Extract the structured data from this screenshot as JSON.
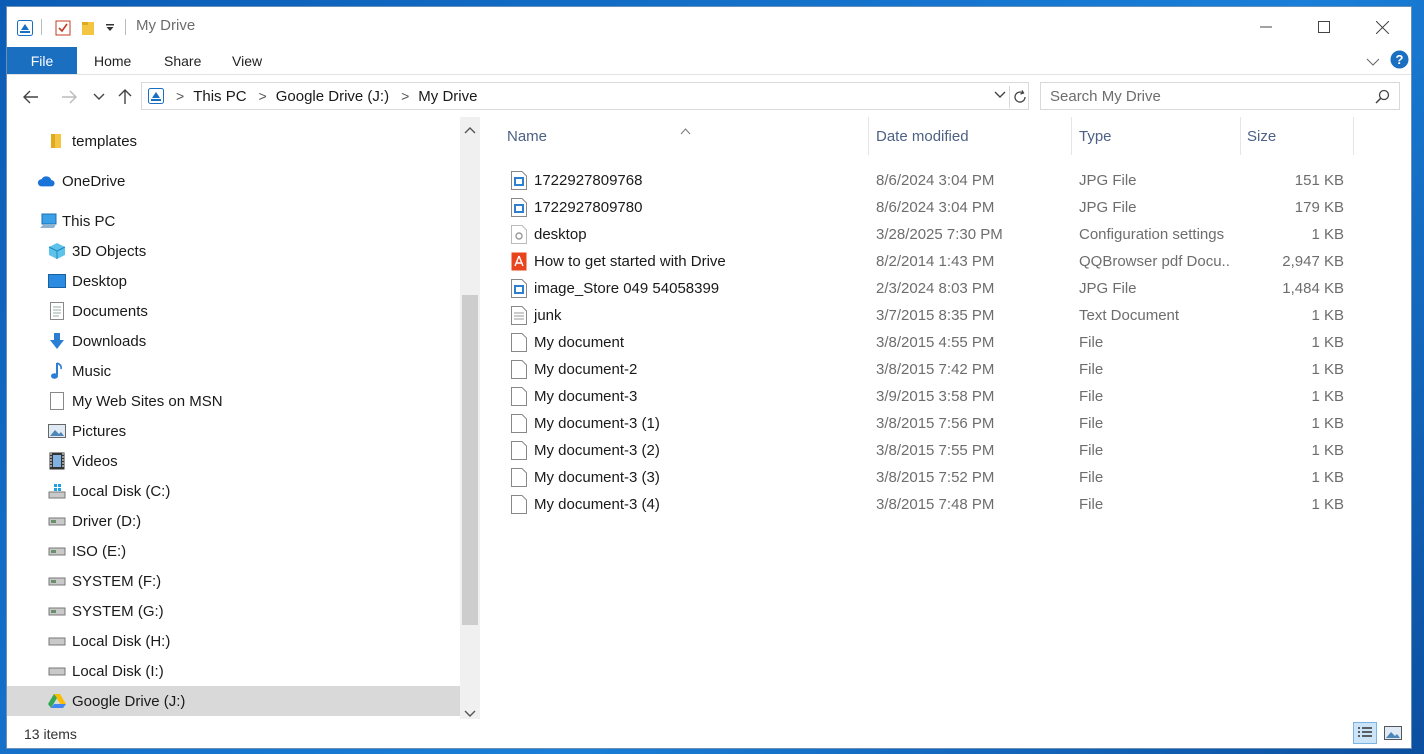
{
  "window": {
    "title": "My Drive"
  },
  "ribbon": {
    "tabs": [
      {
        "label": "File"
      },
      {
        "label": "Home"
      },
      {
        "label": "Share"
      },
      {
        "label": "View"
      }
    ]
  },
  "address": {
    "crumbs": [
      "This PC",
      "Google Drive (J:)",
      "My Drive"
    ]
  },
  "search": {
    "placeholder": "Search My Drive"
  },
  "nav": {
    "items": [
      {
        "label": "templates",
        "icon": "folder-icon"
      },
      {
        "label": "OneDrive",
        "icon": "onedrive-icon"
      },
      {
        "label": "This PC",
        "icon": "this-pc-icon"
      },
      {
        "label": "3D Objects",
        "icon": "3d-objects-icon"
      },
      {
        "label": "Desktop",
        "icon": "desktop-icon"
      },
      {
        "label": "Documents",
        "icon": "documents-icon"
      },
      {
        "label": "Downloads",
        "icon": "downloads-icon"
      },
      {
        "label": "Music",
        "icon": "music-icon"
      },
      {
        "label": "My Web Sites on MSN",
        "icon": "web-sites-icon"
      },
      {
        "label": "Pictures",
        "icon": "pictures-icon"
      },
      {
        "label": "Videos",
        "icon": "videos-icon"
      },
      {
        "label": "Local Disk (C:)",
        "icon": "windows-drive-icon"
      },
      {
        "label": "Driver (D:)",
        "icon": "drive-icon"
      },
      {
        "label": "ISO (E:)",
        "icon": "drive-icon"
      },
      {
        "label": "SYSTEM (F:)",
        "icon": "drive-icon"
      },
      {
        "label": "SYSTEM (G:)",
        "icon": "drive-icon"
      },
      {
        "label": "Local Disk (H:)",
        "icon": "drive-icon"
      },
      {
        "label": "Local Disk (I:)",
        "icon": "drive-icon"
      },
      {
        "label": "Google Drive (J:)",
        "icon": "google-drive-icon",
        "selected": true
      }
    ]
  },
  "columns": [
    {
      "label": "Name"
    },
    {
      "label": "Date modified"
    },
    {
      "label": "Type"
    },
    {
      "label": "Size"
    }
  ],
  "files": [
    {
      "name": "1722927809768",
      "date": "8/6/2024 3:04 PM",
      "type": "JPG File",
      "size": "151 KB",
      "icon": "jpg-file-icon"
    },
    {
      "name": "1722927809780",
      "date": "8/6/2024 3:04 PM",
      "type": "JPG File",
      "size": "179 KB",
      "icon": "jpg-file-icon"
    },
    {
      "name": "desktop",
      "date": "3/28/2025 7:30 PM",
      "type": "Configuration settings",
      "size": "1 KB",
      "icon": "config-file-icon"
    },
    {
      "name": "How to get started with Drive",
      "date": "8/2/2014 1:43 PM",
      "type": "QQBrowser pdf Docu...",
      "size": "2,947 KB",
      "icon": "pdf-file-icon"
    },
    {
      "name": "image_Store 049 54058399",
      "date": "2/3/2024 8:03 PM",
      "type": "JPG File",
      "size": "1,484 KB",
      "icon": "jpg-file-icon"
    },
    {
      "name": "junk",
      "date": "3/7/2015 8:35 PM",
      "type": "Text Document",
      "size": "1 KB",
      "icon": "text-file-icon"
    },
    {
      "name": "My document",
      "date": "3/8/2015 4:55 PM",
      "type": "File",
      "size": "1 KB",
      "icon": "blank-file-icon"
    },
    {
      "name": "My document-2",
      "date": "3/8/2015 7:42 PM",
      "type": "File",
      "size": "1 KB",
      "icon": "blank-file-icon"
    },
    {
      "name": "My document-3",
      "date": "3/9/2015 3:58 PM",
      "type": "File",
      "size": "1 KB",
      "icon": "blank-file-icon"
    },
    {
      "name": "My document-3 (1)",
      "date": "3/8/2015 7:56 PM",
      "type": "File",
      "size": "1 KB",
      "icon": "blank-file-icon"
    },
    {
      "name": "My document-3 (2)",
      "date": "3/8/2015 7:55 PM",
      "type": "File",
      "size": "1 KB",
      "icon": "blank-file-icon"
    },
    {
      "name": "My document-3 (3)",
      "date": "3/8/2015 7:52 PM",
      "type": "File",
      "size": "1 KB",
      "icon": "blank-file-icon"
    },
    {
      "name": "My document-3 (4)",
      "date": "3/8/2015 7:48 PM",
      "type": "File",
      "size": "1 KB",
      "icon": "blank-file-icon"
    }
  ],
  "status": {
    "items_text": "13 items"
  },
  "colors": {
    "accent": "#1a6fc1",
    "selection": "#d9d9d9",
    "header_text": "#4d6185"
  }
}
